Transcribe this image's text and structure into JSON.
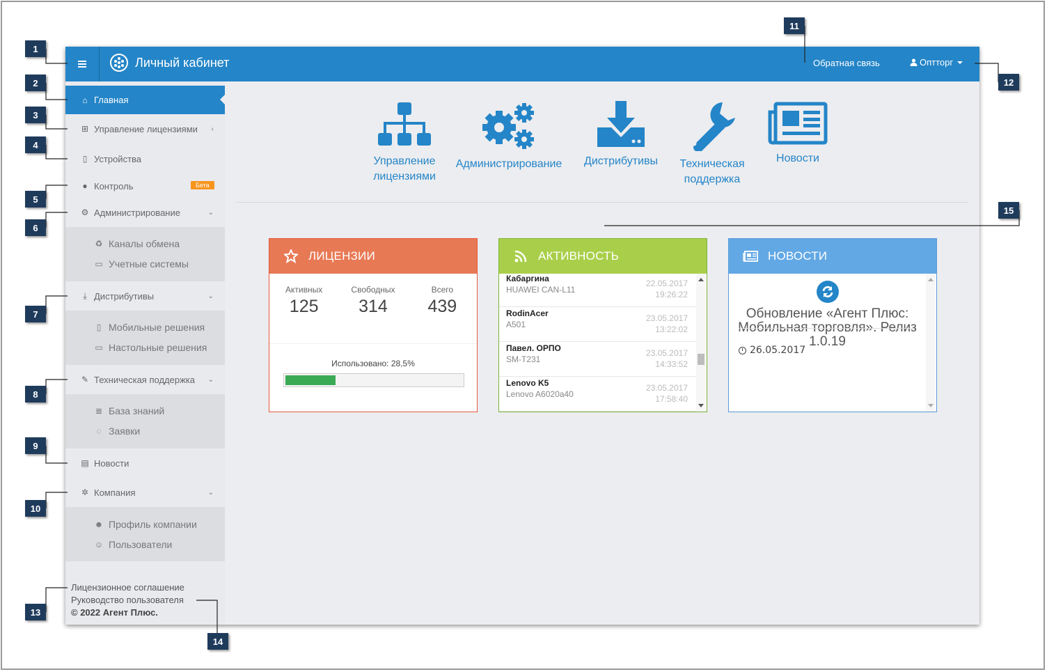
{
  "topbar": {
    "title": "Личный кабинет",
    "feedback": "Обратная связь",
    "user": "Оптторг"
  },
  "sidebar": {
    "items": [
      {
        "label": "Главная",
        "icon": "home-icon",
        "active": true
      },
      {
        "label": "Управление лицензиями",
        "icon": "sitemap-icon",
        "chevron": "left"
      },
      {
        "label": "Устройства",
        "icon": "mobile-icon"
      },
      {
        "label": "Контроль",
        "icon": "globe-icon",
        "badge": "Бета"
      },
      {
        "label": "Администрирование",
        "icon": "cogs-icon",
        "chevron": "down"
      },
      {
        "label": "Дистрибутивы",
        "icon": "download-icon",
        "chevron": "down"
      },
      {
        "label": "Техническая поддержка",
        "icon": "wrench-icon",
        "chevron": "down"
      },
      {
        "label": "Новости",
        "icon": "newspaper-icon"
      },
      {
        "label": "Компания",
        "icon": "cog-icon",
        "chevron": "down"
      }
    ],
    "admin_sub": [
      {
        "label": "Каналы обмена",
        "icon": "recycle-icon"
      },
      {
        "label": "Учетные системы",
        "icon": "desktop-icon"
      }
    ],
    "dist_sub": [
      {
        "label": "Мобильные решения",
        "icon": "mobile-icon"
      },
      {
        "label": "Настольные решения",
        "icon": "laptop-icon"
      }
    ],
    "support_sub": [
      {
        "label": "База знаний",
        "icon": "database-icon"
      },
      {
        "label": "Заявки",
        "icon": "comments-icon"
      }
    ],
    "company_sub": [
      {
        "label": "Профиль компании",
        "icon": "users-icon"
      },
      {
        "label": "Пользователи",
        "icon": "user-plus-icon"
      }
    ],
    "footer": {
      "license": "Лицензионное соглашение",
      "manual": "Руководство пользователя",
      "copyright": "© 2022 Агент Плюс."
    }
  },
  "quick_links": [
    {
      "label": "Управление лицензиями",
      "icon": "sitemap-icon"
    },
    {
      "label": "Администрирование",
      "icon": "cogs-icon"
    },
    {
      "label": "Дистрибутивы",
      "icon": "download-icon"
    },
    {
      "label": "Техническая поддержка",
      "icon": "wrench-icon"
    },
    {
      "label": "Новости",
      "icon": "newspaper-icon"
    }
  ],
  "licenses": {
    "title": "ЛИЦЕНЗИИ",
    "active_label": "Активных",
    "active": "125",
    "free_label": "Свободных",
    "free": "314",
    "total_label": "Всего",
    "total": "439",
    "used_label": "Использовано: 28,5%",
    "used_fraction": 0.285
  },
  "activity": {
    "title": "АКТИВНОСТЬ",
    "rows": [
      {
        "name": "Кабаргина",
        "model": "HUAWEI CAN-L11",
        "date": "22.05.2017",
        "time": "19:26:22"
      },
      {
        "name": "RodinAcer",
        "model": "A501",
        "date": "23.05.2017",
        "time": "13:22:02"
      },
      {
        "name": "Павел. ОРПО",
        "model": "SM-T231",
        "date": "23.05.2017",
        "time": "14:33:52"
      },
      {
        "name": "Lenovo K5",
        "model": "Lenovo A6020a40",
        "date": "23.05.2017",
        "time": "17:58:40"
      }
    ]
  },
  "news": {
    "title": "НОВОСТИ",
    "headline": "Обновление «Агент Плюс: Мобильная торговля». Релиз 1.0.19",
    "date": "26.05.2017"
  },
  "callouts": [
    "1",
    "2",
    "3",
    "4",
    "5",
    "6",
    "7",
    "8",
    "9",
    "10",
    "11",
    "12",
    "13",
    "14",
    "15"
  ],
  "colors": {
    "primary": "#2485c8",
    "licenses": "#e87955",
    "activity": "#a9cf4a",
    "news": "#62a8e5",
    "callout": "#1f3b5c",
    "progress": "#3aaa55"
  }
}
